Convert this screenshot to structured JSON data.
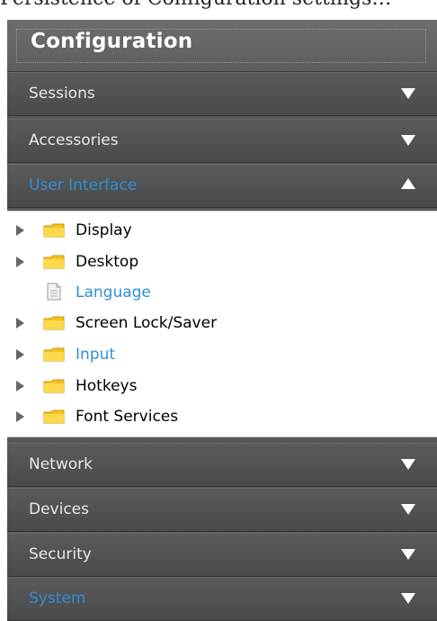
{
  "top_caption": "Persistence of Configuration settings…",
  "header": {
    "title": "Configuration"
  },
  "sections": [
    {
      "label": "Sessions",
      "expanded": false,
      "active": false
    },
    {
      "label": "Accessories",
      "expanded": false,
      "active": false
    },
    {
      "label": "User Interface",
      "expanded": true,
      "active": true
    },
    {
      "label": "Network",
      "expanded": false,
      "active": false
    },
    {
      "label": "Devices",
      "expanded": false,
      "active": false
    },
    {
      "label": "Security",
      "expanded": false,
      "active": false
    },
    {
      "label": "System",
      "expanded": false,
      "active": true
    }
  ],
  "user_interface_items": [
    {
      "label": "Display",
      "type": "folder",
      "link": false
    },
    {
      "label": "Desktop",
      "type": "folder",
      "link": false
    },
    {
      "label": "Language",
      "type": "document",
      "link": true
    },
    {
      "label": "Screen Lock/Saver",
      "type": "folder",
      "link": false
    },
    {
      "label": "Input",
      "type": "folder",
      "link": true
    },
    {
      "label": "Hotkeys",
      "type": "folder",
      "link": false
    },
    {
      "label": "Font Services",
      "type": "folder",
      "link": false
    }
  ],
  "icons": {
    "collapsed": "chevron-down-icon",
    "expanded": "chevron-up-icon",
    "tree_expander": "triangle-right-icon",
    "folder": "folder-icon",
    "document": "document-icon"
  },
  "colors": {
    "panel": "#575757",
    "active_text": "#2e8fd6",
    "section_text": "#e8e8e8"
  }
}
